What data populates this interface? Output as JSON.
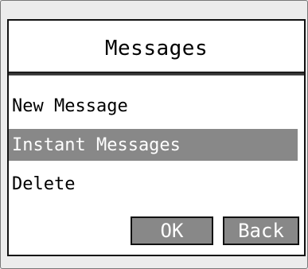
{
  "screen": {
    "title": "Messages"
  },
  "menu": {
    "items": [
      {
        "label": "New Message",
        "selected": false
      },
      {
        "label": "Instant Messages",
        "selected": true
      },
      {
        "label": "Delete",
        "selected": false
      }
    ]
  },
  "softkeys": {
    "ok_label": "OK",
    "back_label": "Back"
  },
  "colors": {
    "selection": "#888888",
    "screen_background": "#ffffff",
    "frame": "#ececec"
  }
}
